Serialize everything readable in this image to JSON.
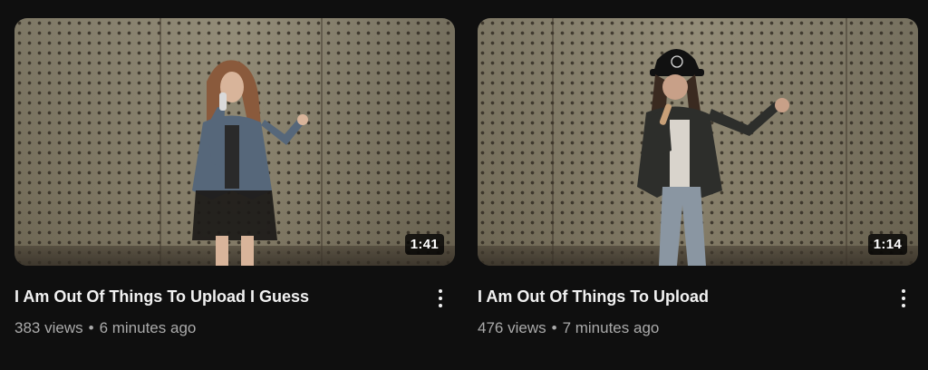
{
  "videos": [
    {
      "title": "I Am Out Of Things To Upload I Guess",
      "duration": "1:41",
      "views": "383 views",
      "age": "6 minutes ago",
      "separator": "•"
    },
    {
      "title": "I Am Out Of Things To Upload",
      "duration": "1:14",
      "views": "476 views",
      "age": "7 minutes ago",
      "separator": "•"
    }
  ],
  "icons": {
    "menu": "more-vert-icon"
  },
  "colors": {
    "background": "#0f0f0f",
    "title": "#f1f1f1",
    "meta": "#aaaaaa",
    "duration_badge": "#000000"
  }
}
